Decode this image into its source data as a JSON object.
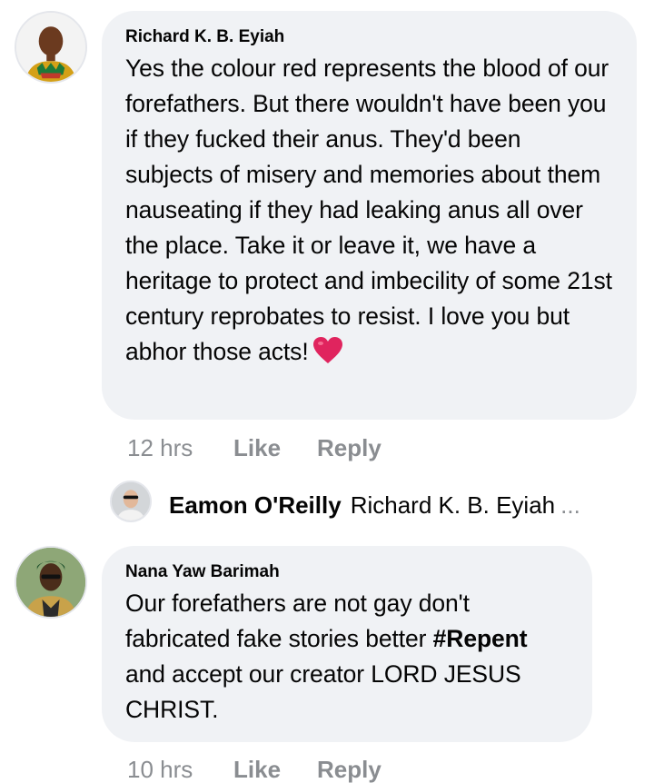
{
  "comments": [
    {
      "author": "Richard K. B. Eyiah",
      "text": "Yes the colour red represents the blood of our forefathers. But there wouldn't have been you if they fucked their anus. They'd been subjects of misery and memories about them nauseating if they had leaking anus all over the place. Take it or leave it, we have a heritage to protect and imbecility of some 21st century reprobates to resist. I love you but abhor those acts!",
      "emoji": "red-heart",
      "time": "12 hrs",
      "like_label": "Like",
      "reply_label": "Reply"
    },
    {
      "author": "Nana Yaw Barimah",
      "text_before": "Our forefathers are not gay don't fabricated fake stories better",
      "hashtag": "#Repent",
      "text_after": "and accept our creator LORD JESUS CHRIST.",
      "time": "10 hrs",
      "like_label": "Like",
      "reply_label": "Reply"
    }
  ],
  "reply_preview": {
    "author": "Eamon O'Reilly",
    "text": "Richard K. B. Eyiah",
    "ellipsis": "..."
  },
  "colors": {
    "bubble": "#f0f2f5",
    "meta_text": "#8a8d91",
    "heart": "#e0245e"
  }
}
